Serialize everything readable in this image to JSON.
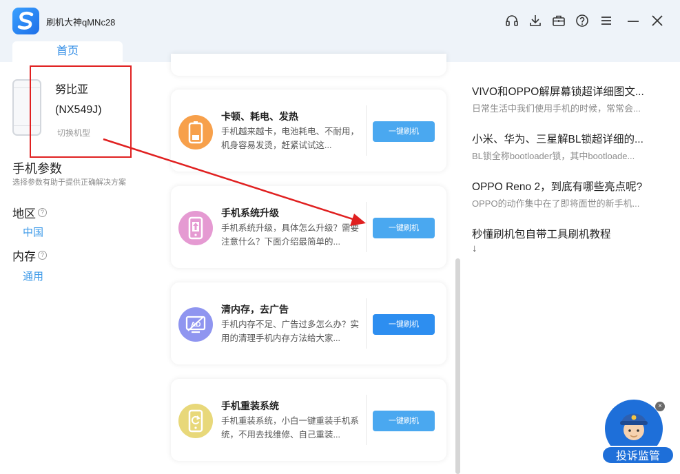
{
  "window": {
    "title": "刷机大神qMNc28",
    "tabs": [
      {
        "label": "首页"
      }
    ],
    "controls": [
      "headset-icon",
      "download-icon",
      "toolbox-icon",
      "help-icon",
      "menu-icon",
      "minimize-icon",
      "close-icon"
    ]
  },
  "device": {
    "name": "努比亚",
    "model": "(NX549J)",
    "switch_label": "切换机型"
  },
  "params": {
    "title": "手机参数",
    "subtitle": "选择参数有助于提供正确解决方案",
    "items": [
      {
        "label": "地区",
        "value": "中国"
      },
      {
        "label": "内存",
        "value": "通用"
      }
    ]
  },
  "cards": [
    {
      "title": "卡顿、耗电、发热",
      "desc": "手机越来越卡，电池耗电、不耐用，机身容易发烫，赶紧试试这...",
      "button": "一键刷机",
      "icon": "battery-icon",
      "icon_color": "#f7a04b"
    },
    {
      "title": "手机系统升级",
      "desc": "手机系统升级，具体怎么升级？需要注意什么？下面介绍最简单的...",
      "button": "一键刷机",
      "icon": "phone-upgrade-icon",
      "icon_color": "#e59ad2"
    },
    {
      "title": "清内存，去广告",
      "desc": "手机内存不足、广告过多怎么办？实用的清理手机内存方法给大家...",
      "button": "一键刷机",
      "icon": "ad-block-icon",
      "icon_color": "#8f95f0"
    },
    {
      "title": "手机重装系统",
      "desc": "手机重装系统，小白一键重装手机系统，不用去找维修、自己重装...",
      "button": "一键刷机",
      "icon": "phone-reset-icon",
      "icon_color": "#e8d87a"
    }
  ],
  "articles": [
    {
      "title": "VIVO和OPPO解屏幕锁超详细图文...",
      "subtitle": "日常生活中我们使用手机的时候，常常会..."
    },
    {
      "title": "小米、华为、三星解BL锁超详细的...",
      "subtitle": "BL锁全称bootloader锁，其中bootloade..."
    },
    {
      "title": "OPPO Reno 2，到底有哪些亮点呢?",
      "subtitle": "OPPO的动作集中在了即将面世的新手机..."
    },
    {
      "title": "秒懂刷机包自带工具刷机教程",
      "subtitle": "↓"
    }
  ],
  "mascot": {
    "label": "投诉监管",
    "close": "×"
  },
  "colors": {
    "accent": "#2e8be6",
    "button": "#4aa8f0",
    "button_active": "#2d8ef0",
    "annotation": "#e02020"
  }
}
